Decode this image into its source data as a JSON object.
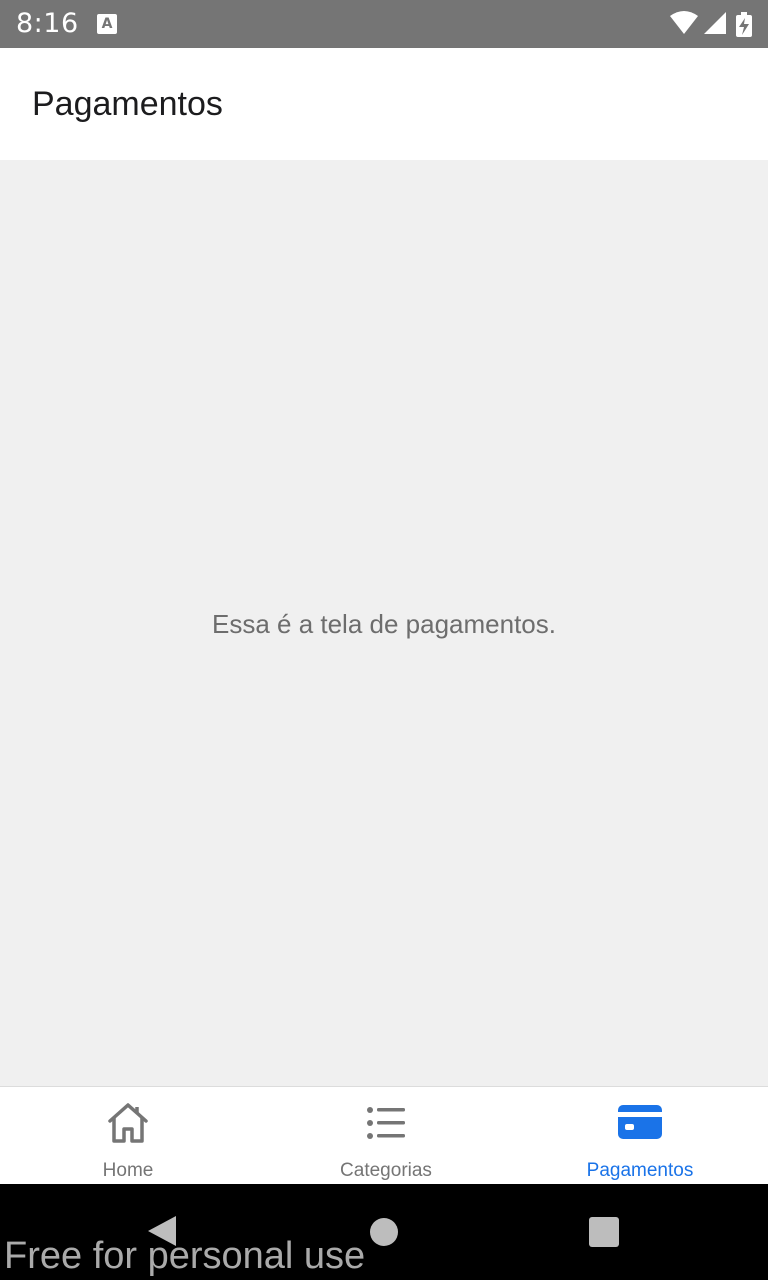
{
  "status_bar": {
    "time": "8:16",
    "notification_icon": "a-icon",
    "icons": [
      "wifi-icon",
      "signal-icon",
      "battery-charging-icon"
    ]
  },
  "app_bar": {
    "title": "Pagamentos"
  },
  "content": {
    "message": "Essa é a tela de pagamentos."
  },
  "tab_bar": {
    "active_color": "#1a73e8",
    "inactive_color": "#757575",
    "tabs": [
      {
        "label": "Home",
        "icon": "home-icon",
        "active": false
      },
      {
        "label": "Categorias",
        "icon": "list-icon",
        "active": false
      },
      {
        "label": "Pagamentos",
        "icon": "credit-card-icon",
        "active": true
      }
    ]
  },
  "nav_bar": {
    "buttons": [
      "back-icon",
      "home-circle-icon",
      "recents-square-icon"
    ]
  },
  "watermark": {
    "text": "Free for personal use"
  }
}
